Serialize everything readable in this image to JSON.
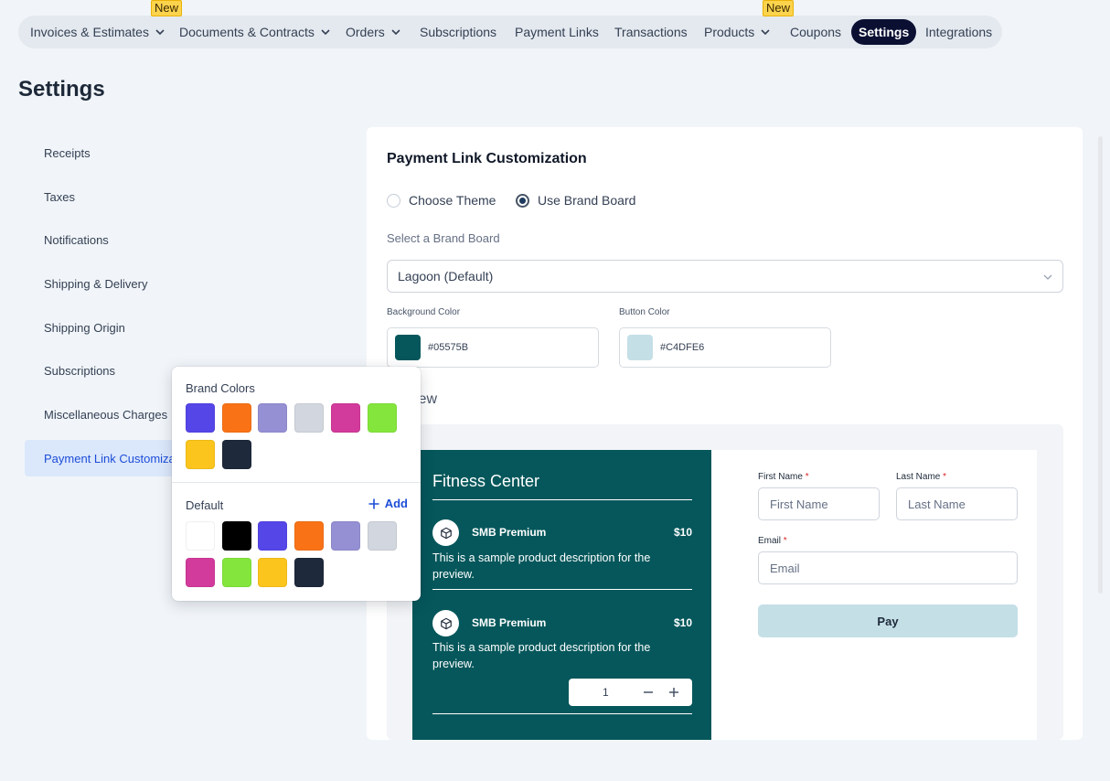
{
  "nav": {
    "items": [
      {
        "label": "Invoices & Estimates",
        "dropdown": true,
        "badge": ""
      },
      {
        "label": "Documents & Contracts",
        "dropdown": true,
        "badge": ""
      },
      {
        "label": "Orders",
        "dropdown": true,
        "badge": ""
      },
      {
        "label": "Subscriptions",
        "dropdown": false,
        "badge": ""
      },
      {
        "label": "Payment Links",
        "dropdown": false,
        "badge": ""
      },
      {
        "label": "Transactions",
        "dropdown": false,
        "badge": ""
      },
      {
        "label": "Products",
        "dropdown": true,
        "badge": ""
      },
      {
        "label": "Coupons",
        "dropdown": false,
        "badge": ""
      },
      {
        "label": "Settings",
        "dropdown": false,
        "badge": "",
        "active": true
      },
      {
        "label": "Integrations",
        "dropdown": false,
        "badge": ""
      }
    ],
    "badges": [
      "New",
      "New"
    ]
  },
  "page_title": "Settings",
  "sidebar": {
    "items": [
      {
        "label": "Receipts"
      },
      {
        "label": "Taxes"
      },
      {
        "label": "Notifications"
      },
      {
        "label": "Shipping & Delivery"
      },
      {
        "label": "Shipping Origin"
      },
      {
        "label": "Subscriptions"
      },
      {
        "label": "Miscellaneous Charges"
      },
      {
        "label": "Payment Link Customizat",
        "active": true
      }
    ]
  },
  "panel": {
    "title": "Payment Link Customization",
    "radio_choose_theme": "Choose Theme",
    "radio_use_brand_board": "Use Brand Board",
    "selected_radio": "Use Brand Board",
    "brand_board_label": "Select a Brand Board",
    "brand_board_value": "Lagoon (Default)",
    "background_color_label": "Background Color",
    "background_color_value": "#05575B",
    "button_color_label": "Button Color",
    "button_color_value": "#C4DFE6",
    "preview_label": "iew"
  },
  "preview": {
    "store_name": "Fitness Center",
    "products": [
      {
        "name": "SMB Premium",
        "price": "$10",
        "description": "This is a sample product description for the preview."
      },
      {
        "name": "SMB Premium",
        "price": "$10",
        "description": "This is a sample product description for the preview.",
        "quantity": "1"
      }
    ],
    "form": {
      "first_name_label": "First Name",
      "first_name_placeholder": "First Name",
      "last_name_label": "Last Name",
      "last_name_placeholder": "Last Name",
      "email_label": "Email",
      "email_placeholder": "Email",
      "required_mark": "*",
      "pay_label": "Pay"
    }
  },
  "color_picker": {
    "brand_colors_title": "Brand Colors",
    "brand_colors": [
      "#5546e8",
      "#f97316",
      "#9590d4",
      "#d2d6de",
      "#d23a9b",
      "#84e63c",
      "#fbc51d",
      "#1e293b"
    ],
    "default_title": "Default",
    "add_label": "Add",
    "default_colors": [
      "#ffffff",
      "#000000",
      "#5546e8",
      "#f97316",
      "#9590d4",
      "#d2d6de",
      "#d23a9b",
      "#84e63c",
      "#fbc51d",
      "#1e293b"
    ]
  },
  "colors": {
    "accent": "#1d4ed8",
    "nav_active_bg": "#0b1033",
    "preview_dark": "#05575b",
    "button": "#c4dfe6",
    "badge": "#fcd34d"
  }
}
